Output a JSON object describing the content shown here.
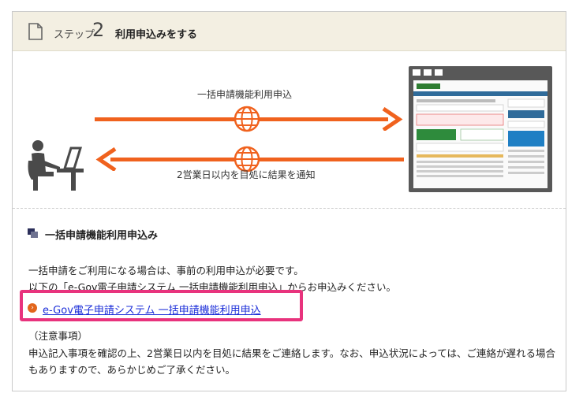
{
  "step": {
    "word": "ステップ",
    "number": "2",
    "title": "利用申込みをする"
  },
  "illustration": {
    "top_label": "一括申請機能利用申込",
    "bottom_label": "2営業日以内を目処に結果を通知",
    "arrow_color": "#f0621e",
    "globe_color": "#f0621e"
  },
  "section": {
    "title": "一括申請機能利用申込み",
    "line1": "一括申請をご利用になる場合は、事前の利用申込が必要です。",
    "line2": "以下の「e-Gov電子申請システム 一括申請機能利用申込」からお申込みください。",
    "link_label": "e-Gov電子申請システム 一括申請機能利用申込",
    "note_heading": "（注意事項）",
    "note_line1": "申込記入事項を確認の上、2営業日以内を目処に結果をご連絡します。なお、申込状況によっては、ご連絡が遅れる場合",
    "note_line2": "もありますので、あらかじめご了承ください。"
  },
  "colors": {
    "header_bg": "#f3efe2",
    "highlight": "#e8337d",
    "link": "#1a2dd8"
  }
}
